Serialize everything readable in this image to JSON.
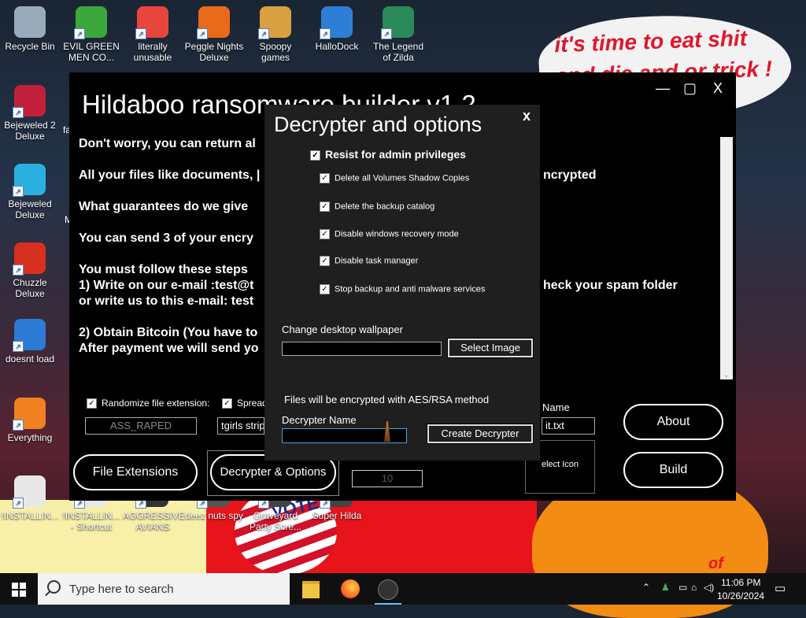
{
  "desktop": {
    "icons": [
      {
        "label": "Recycle Bin",
        "color": "#9ab"
      },
      {
        "label": "EVIL GREEN MEN CO...",
        "color": "#3ca83c"
      },
      {
        "label": "literally unusable",
        "color": "#e8453c"
      },
      {
        "label": "Peggle Nights Deluxe",
        "color": "#e86a1a"
      },
      {
        "label": "Spoopy games",
        "color": "#d8a040"
      },
      {
        "label": "HalloDock",
        "color": "#2d7fd6"
      },
      {
        "label": "The Legend of Zilda",
        "color": "#2a8a5a"
      },
      {
        "label": "Bejeweled 2 Deluxe",
        "color": "#c0203a"
      },
      {
        "label": "Bejeweled Deluxe",
        "color": "#2ab0e0"
      },
      {
        "label": "Chuzzle Deluxe",
        "color": "#d83020"
      },
      {
        "label": "doesnt load",
        "color": "#2c7bd4"
      },
      {
        "label": "Everything",
        "color": "#f08020"
      },
      {
        "label": "!INSTALLIN...",
        "color": "#e8e8e8"
      },
      {
        "label": "!INSTALLIN... - Shortcut",
        "color": "#e8e8e8"
      },
      {
        "label": "AGGRESSIVE AVIANS",
        "color": "#333"
      },
      {
        "label": "deez nuts spy",
        "color": "#555"
      },
      {
        "label": "Graveyard Party Scre...",
        "color": "#444"
      },
      {
        "label": "Super Hilda",
        "color": "#444"
      }
    ],
    "cloud_text": "it's time to eat shit and die and or trick !",
    "partial_labels": {
      "fa": "fa",
      "m": "M",
      "vote": "VOTE",
      "of": "of"
    }
  },
  "window": {
    "title": "Hildaboo ransomware builder v1.2",
    "minimize": "—",
    "maximize": "▢",
    "close": "X",
    "lines": [
      "Don't worry, you can return al",
      "All your files like documents, |",
      "What guarantees do we give",
      "You can send 3 of your encry",
      "You must follow these steps",
      "1) Write on our e-mail :test@t",
      "or write us to this e-mail: test",
      "2) Obtain Bitcoin (You have to",
      "After payment we will send yo"
    ],
    "right_fragments": {
      "encrypted": "ncrypted",
      "spam": "heck your spam folder"
    },
    "randomize_label": "Randomize file extension:",
    "spread_label": "Spread",
    "extension_value": "ASS_RAPED",
    "spread_value": "tgirls strip",
    "name_label": "Name",
    "name_value": "it.txt",
    "select_icon": "elect Icon",
    "counter_value": "10",
    "file_extensions_btn": "File Extensions",
    "decrypter_options_btn": "Decrypter & Options",
    "about_btn": "About",
    "build_btn": "Build"
  },
  "dialog": {
    "title": "Decrypter and options",
    "close": "x",
    "resist": "Resist for admin privileges",
    "options": [
      "Delete all Volumes Shadow Copies",
      "Delete the backup catalog",
      "Disable windows recovery mode",
      "Disable task manager",
      "Stop backup and anti malware services"
    ],
    "wallpaper_label": "Change desktop wallpaper",
    "wallpaper_value": "",
    "select_image": "Select Image",
    "aes_note": "Files will be encrypted with AES/RSA method",
    "decrypter_name_label": "Decrypter Name",
    "decrypter_name_value": "",
    "create_decrypter": "Create Decrypter"
  },
  "taskbar": {
    "search_placeholder": "Type here to search",
    "time": "11:06 PM",
    "date": "10/26/2024"
  }
}
